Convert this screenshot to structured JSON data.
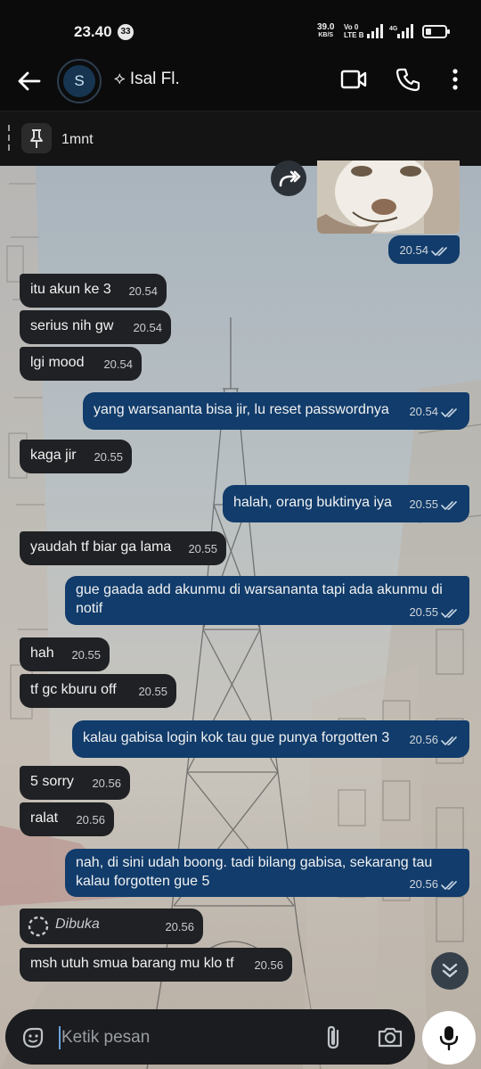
{
  "status_bar": {
    "time": "23.40",
    "notification_count": "33",
    "net_speed_value": "39.0",
    "net_speed_unit": "KB/S",
    "volte_top": "Vo 0",
    "volte_bottom": "LTE B",
    "network_type": "4G"
  },
  "header": {
    "avatar_letter": "S",
    "contact_name": "⟡ Isal Fl."
  },
  "pinned": {
    "text": "1mnt"
  },
  "messages": [
    {
      "dir": "out",
      "text": "",
      "time": "20.54",
      "read": true
    },
    {
      "dir": "in",
      "text": "itu akun ke 3",
      "time": "20.54"
    },
    {
      "dir": "in",
      "text": "serius nih gw",
      "time": "20.54"
    },
    {
      "dir": "in",
      "text": "lgi mood",
      "time": "20.54"
    },
    {
      "dir": "out",
      "text": "yang warsananta bisa jir, lu reset passwordnya",
      "time": "20.54",
      "read": true
    },
    {
      "dir": "in",
      "text": "kaga jir",
      "time": "20.55"
    },
    {
      "dir": "out",
      "text": "halah, orang buktinya iya",
      "time": "20.55",
      "read": true
    },
    {
      "dir": "in",
      "text": "yaudah tf biar ga lama",
      "time": "20.55"
    },
    {
      "dir": "out",
      "text": "gue gaada add akunmu di warsananta tapi ada akunmu di notif",
      "time": "20.55",
      "read": true
    },
    {
      "dir": "in",
      "text": "hah",
      "time": "20.55"
    },
    {
      "dir": "in",
      "text": "tf gc kburu off",
      "time": "20.55"
    },
    {
      "dir": "out",
      "text": "kalau gabisa login kok tau gue punya forgotten 3",
      "time": "20.56",
      "read": true
    },
    {
      "dir": "in",
      "text": "5 sorry",
      "time": "20.56"
    },
    {
      "dir": "in",
      "text": "ralat",
      "time": "20.56"
    },
    {
      "dir": "out",
      "text": "nah, di sini udah boong. tadi bilang gabisa, sekarang tau kalau forgotten gue 5",
      "time": "20.56",
      "read": true
    },
    {
      "dir": "in",
      "text": "Dibuka",
      "time": "20.56",
      "view_once": true
    },
    {
      "dir": "in",
      "text": "msh utuh smua barang mu klo tf",
      "time": "20.56"
    }
  ],
  "composer": {
    "placeholder": "Ketik pesan"
  },
  "colors": {
    "incoming_bubble": "#1f2124",
    "outgoing_bubble": "#113c6b",
    "app_bar": "#0b0b0b"
  }
}
